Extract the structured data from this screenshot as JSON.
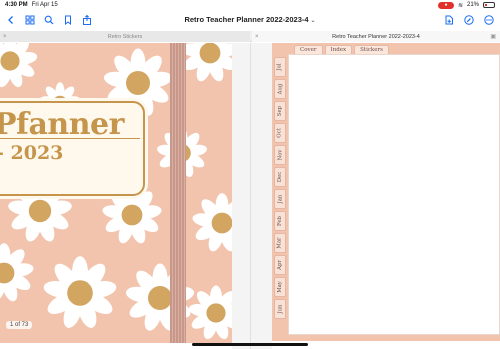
{
  "status_bar": {
    "time": "4:30 PM",
    "date": "Fri Apr 15",
    "battery": "21%"
  },
  "toolbar": {
    "document_title": "Retro Teacher Planner 2022-2023-4",
    "icons": [
      "back-icon",
      "grid-icon",
      "search-icon",
      "bookmark-icon",
      "share-icon",
      "add-page-icon",
      "edit-icon",
      "more-icon"
    ]
  },
  "tabs": {
    "left_tab": "Retro Stickers",
    "right_tab": "Retro Teacher Planner 2022-2023-4"
  },
  "cover": {
    "title": "Pfanner",
    "year": "2023",
    "page_indicator": "1 of 73"
  },
  "planner": {
    "top_tabs": [
      "Cover",
      "Index",
      "Stickers"
    ],
    "side_tabs": [
      "Jul",
      "Aug",
      "Sep",
      "Oct",
      "Nov",
      "Dec",
      "Jan",
      "Feb",
      "Mar",
      "Apr",
      "May",
      "Jun"
    ]
  },
  "colors": {
    "accent": "#1b6ef5",
    "cover_bg": "#f2c4ad",
    "gold": "#c6954c"
  }
}
